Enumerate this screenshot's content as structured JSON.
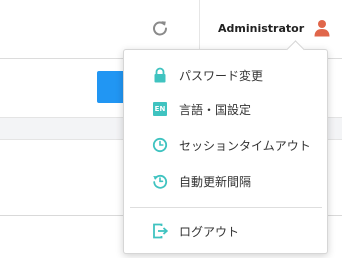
{
  "header": {
    "user_name": "Administrator"
  },
  "user_menu": {
    "items": [
      {
        "label": "パスワード変更",
        "icon": "lock-icon"
      },
      {
        "label": "言語・国設定",
        "icon": "language-en-icon",
        "icon_text": "EN"
      },
      {
        "label": "セッションタイムアウト",
        "icon": "clock-icon"
      },
      {
        "label": "自動更新間隔",
        "icon": "auto-refresh-clock-icon"
      }
    ],
    "logout_label": "ログアウト"
  },
  "colors": {
    "accent": "#3fc3c0",
    "user_icon": "#e0664a",
    "primary_button": "#2196f3"
  }
}
